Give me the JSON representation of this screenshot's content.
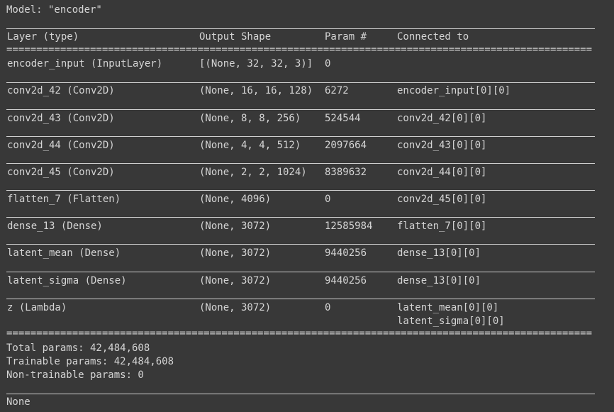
{
  "model_title": "Model: \"encoder\"",
  "headers": {
    "layer": "Layer (type)",
    "shape": "Output Shape",
    "param": "Param #",
    "connected": "Connected to"
  },
  "double_rule": "==================================================================================================",
  "rows": [
    {
      "layer": "encoder_input (InputLayer)",
      "shape": "[(None, 32, 32, 3)]",
      "param": "0",
      "connected": ""
    },
    {
      "layer": "conv2d_42 (Conv2D)",
      "shape": "(None, 16, 16, 128)",
      "param": "6272",
      "connected": "encoder_input[0][0]"
    },
    {
      "layer": "conv2d_43 (Conv2D)",
      "shape": "(None, 8, 8, 256)",
      "param": "524544",
      "connected": "conv2d_42[0][0]"
    },
    {
      "layer": "conv2d_44 (Conv2D)",
      "shape": "(None, 4, 4, 512)",
      "param": "2097664",
      "connected": "conv2d_43[0][0]"
    },
    {
      "layer": "conv2d_45 (Conv2D)",
      "shape": "(None, 2, 2, 1024)",
      "param": "8389632",
      "connected": "conv2d_44[0][0]"
    },
    {
      "layer": "flatten_7 (Flatten)",
      "shape": "(None, 4096)",
      "param": "0",
      "connected": "conv2d_45[0][0]"
    },
    {
      "layer": "dense_13 (Dense)",
      "shape": "(None, 3072)",
      "param": "12585984",
      "connected": "flatten_7[0][0]"
    },
    {
      "layer": "latent_mean (Dense)",
      "shape": "(None, 3072)",
      "param": "9440256",
      "connected": "dense_13[0][0]"
    },
    {
      "layer": "latent_sigma (Dense)",
      "shape": "(None, 3072)",
      "param": "9440256",
      "connected": "dense_13[0][0]"
    },
    {
      "layer": "z (Lambda)",
      "shape": "(None, 3072)",
      "param": "0",
      "connected": "latent_mean[0][0]",
      "connected_2": "latent_sigma[0][0]"
    }
  ],
  "summary": {
    "total": "Total params: 42,484,608",
    "trainable": "Trainable params: 42,484,608",
    "non_trainable": "Non-trainable params: 0"
  },
  "return_value": "None",
  "colors": {
    "background": "#383838",
    "text": "#d4d4d4",
    "rule": "#cfcfcf"
  }
}
